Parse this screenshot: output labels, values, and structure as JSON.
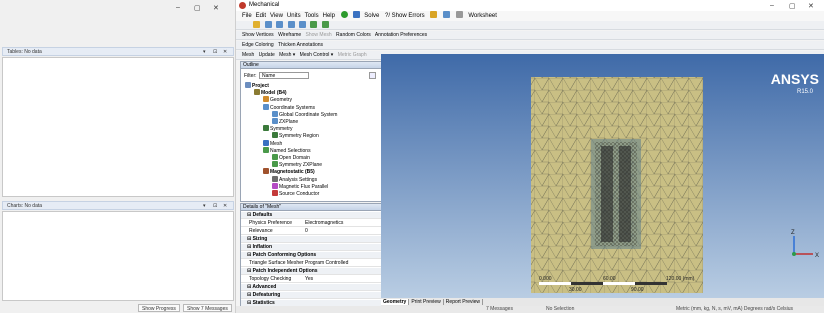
{
  "left_window": {
    "controls": [
      "–",
      "▢",
      "✕"
    ],
    "tables_pane": {
      "title": "Tables: No data",
      "controls": [
        "▾",
        "⊡",
        "✕"
      ]
    },
    "charts_pane": {
      "title": "Charts: No data",
      "controls": [
        "▾",
        "⊡",
        "✕"
      ]
    },
    "footer_buttons": [
      "Show Progress",
      "Show 7 Messages"
    ]
  },
  "mech": {
    "title": "Mechanical",
    "controls": [
      "–",
      "▢",
      "✕"
    ],
    "menus": [
      "File",
      "Edit",
      "View",
      "Units",
      "Tools",
      "Help"
    ],
    "toolbar1": {
      "solve": "Solve",
      "show_errors": "?/ Show Errors",
      "worksheet": "Worksheet"
    },
    "toolbar3": {
      "show_vertices": "Show Vertices",
      "wireframe": "Wireframe",
      "show_mesh": "Show Mesh",
      "random_colors": "Random Colors",
      "annotation_prefs": "Annotation Preferences"
    },
    "toolbar4": {
      "edge_coloring": "Edge Coloring",
      "thicken": "Thicken Annotations"
    },
    "toolbar5": {
      "mesh": "Mesh",
      "update": "Update",
      "mesh_dd": "Mesh ▾",
      "mesh_control": "Mesh Control ▾",
      "metric": "Metric Graph"
    },
    "outline": {
      "title": "Outline",
      "filter_label": "Filter:",
      "filter_value": "Name",
      "tree": [
        {
          "label": "Project",
          "indent": 0,
          "bold": true,
          "icon": "project-icon",
          "color": "#6c8ebf"
        },
        {
          "label": "Model (B4)",
          "indent": 1,
          "bold": true,
          "icon": "model-icon",
          "color": "#8a7b33"
        },
        {
          "label": "Geometry",
          "indent": 2,
          "bold": false,
          "icon": "geometry-icon",
          "color": "#d08b2c"
        },
        {
          "label": "Coordinate Systems",
          "indent": 2,
          "bold": false,
          "icon": "coordinate-icon",
          "color": "#5a8fc9"
        },
        {
          "label": "Global Coordinate System",
          "indent": 3,
          "bold": false,
          "icon": "axis-icon",
          "color": "#5a8fc9"
        },
        {
          "label": "ZXPlane",
          "indent": 3,
          "bold": false,
          "icon": "axis-icon",
          "color": "#5a8fc9"
        },
        {
          "label": "Symmetry",
          "indent": 2,
          "bold": false,
          "icon": "symmetry-icon",
          "color": "#3b7a3b"
        },
        {
          "label": "Symmetry Region",
          "indent": 3,
          "bold": false,
          "icon": "symmetry-region-icon",
          "color": "#3b7a3b"
        },
        {
          "label": "Mesh",
          "indent": 2,
          "bold": false,
          "icon": "mesh-icon",
          "color": "#3a71c1"
        },
        {
          "label": "Named Selections",
          "indent": 2,
          "bold": false,
          "icon": "named-selection-icon",
          "color": "#4a9a4a"
        },
        {
          "label": "Open Domain",
          "indent": 3,
          "bold": false,
          "icon": "selection-icon",
          "color": "#4a9a4a"
        },
        {
          "label": "Symmetry ZXPlane",
          "indent": 3,
          "bold": false,
          "icon": "selection-icon",
          "color": "#4a9a4a"
        },
        {
          "label": "Magnetostatic (B5)",
          "indent": 2,
          "bold": true,
          "icon": "magnetostatic-icon",
          "color": "#a0522d"
        },
        {
          "label": "Analysis Settings",
          "indent": 3,
          "bold": false,
          "icon": "settings-icon",
          "color": "#6d6d6d"
        },
        {
          "label": "Magnetic Flux Parallel",
          "indent": 3,
          "bold": false,
          "icon": "flux-icon",
          "color": "#b44ac4"
        },
        {
          "label": "Source Conductor",
          "indent": 3,
          "bold": false,
          "icon": "conductor-icon",
          "color": "#c43a3a"
        }
      ]
    },
    "details": {
      "title": "Details of \"Mesh\"",
      "rows": [
        {
          "k": "Defaults",
          "v": "",
          "grp": true
        },
        {
          "k": "Physics Preference",
          "v": "Electromagnetics",
          "grp": false
        },
        {
          "k": "Relevance",
          "v": "0",
          "grp": false
        },
        {
          "k": "Sizing",
          "v": "",
          "grp": true
        },
        {
          "k": "Inflation",
          "v": "",
          "grp": true
        },
        {
          "k": "Patch Conforming Options",
          "v": "",
          "grp": true
        },
        {
          "k": "Triangle Surface Mesher",
          "v": "Program Controlled",
          "grp": false
        },
        {
          "k": "Patch Independent Options",
          "v": "",
          "grp": true
        },
        {
          "k": "Topology Checking",
          "v": "Yes",
          "grp": false
        },
        {
          "k": "Advanced",
          "v": "",
          "grp": true
        },
        {
          "k": "Defeaturing",
          "v": "",
          "grp": true
        },
        {
          "k": "Statistics",
          "v": "",
          "grp": true
        }
      ]
    },
    "graphics": {
      "brand": "ANSYS",
      "version": "R15.0",
      "scale_labels": [
        "0.000",
        "60.00",
        "120.00 (mm)"
      ],
      "scale_labels_sub": [
        "30.00",
        "90.00"
      ],
      "triad_z": "Z",
      "triad_x": "X"
    },
    "tabs": [
      "Geometry",
      "Print Preview",
      "Report Preview"
    ],
    "status": {
      "messages": "7 Messages",
      "selection": "No Selection",
      "units": "Metric (mm, kg, N, s, mV, mA)  Degrees  rad/s  Celsius"
    },
    "colors": {
      "background_top": "#3f6aa8",
      "background_bottom": "#b9cde3",
      "mesh_fill": "#c9bf84",
      "mesh_line": "#6c6a52",
      "brand": "#ffffff"
    }
  }
}
